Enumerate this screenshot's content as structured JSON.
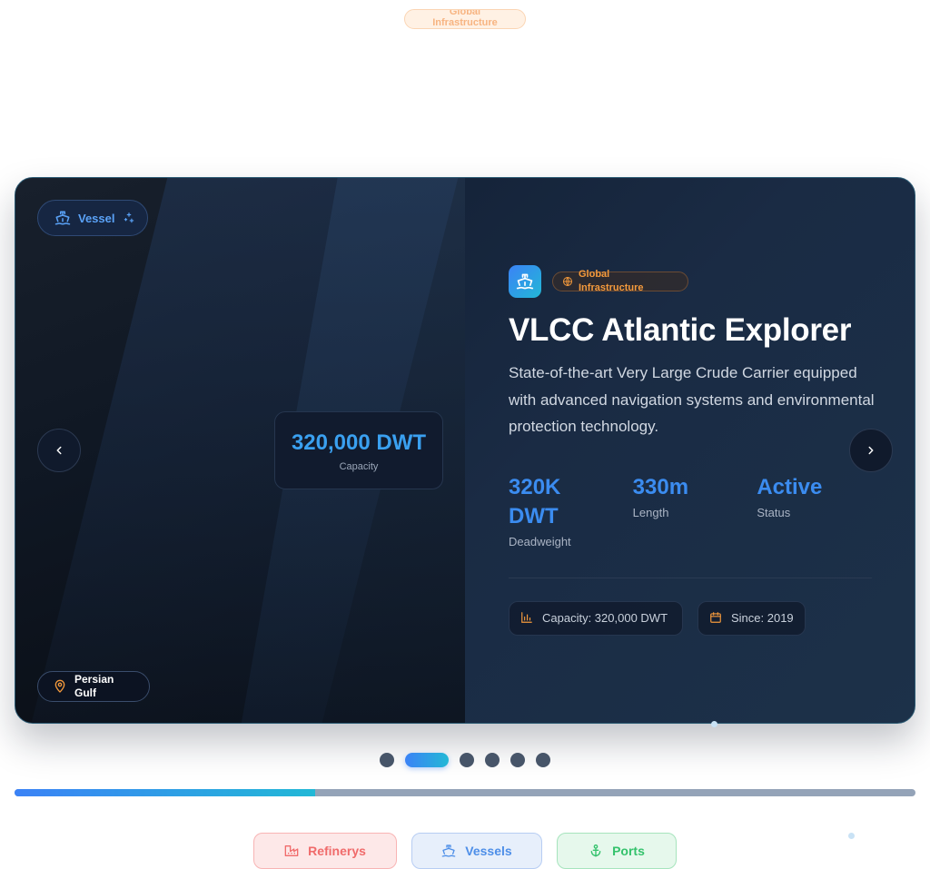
{
  "header": {
    "badge": "Global Infrastructure"
  },
  "slide": {
    "type_badge": "Vessel",
    "location": "Persian Gulf",
    "capacity_value": "320,000 DWT",
    "capacity_label": "Capacity",
    "category_badge": "Global Infrastructure",
    "title": "VLCC Atlantic Explorer",
    "description": "State-of-the-art Very Large Crude Carrier equipped with advanced navigation systems and environmental protection technology.",
    "stats": [
      {
        "value": "320K DWT",
        "label": "Deadweight"
      },
      {
        "value": "330m",
        "label": "Length"
      },
      {
        "value": "Active",
        "label": "Status"
      }
    ],
    "meta": [
      {
        "icon": "bar-chart-icon",
        "text": "Capacity: 320,000 DWT"
      },
      {
        "icon": "calendar-icon",
        "text": "Since: 2019"
      }
    ]
  },
  "carousel": {
    "slide_count": 6,
    "active_index": 1,
    "progress": 0.334
  },
  "categories": [
    {
      "label": "Refinerys",
      "icon": "factory-icon"
    },
    {
      "label": "Vessels",
      "icon": "ship-icon"
    },
    {
      "label": "Ports",
      "icon": "anchor-icon"
    }
  ],
  "colors": {
    "accent": "#3b82f6",
    "accent2": "#22b8d6",
    "orange": "#f59a3c"
  }
}
